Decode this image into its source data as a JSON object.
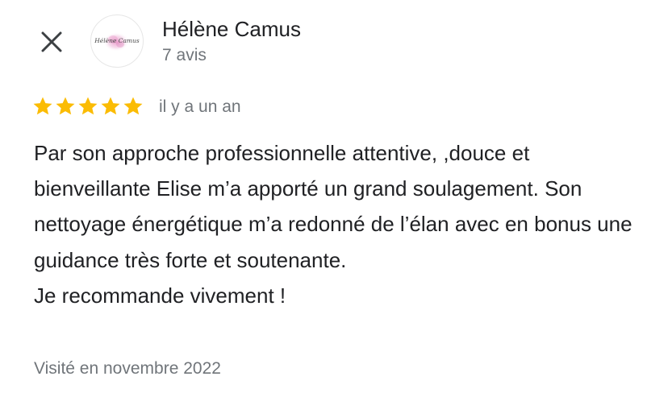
{
  "header": {
    "close_icon": "close-icon",
    "author": {
      "name": "Hélène Camus",
      "review_count": "7 avis",
      "avatar_signature": "Hélène Camus",
      "avatar_accent_color": "#e58ec2"
    }
  },
  "review": {
    "rating": 5,
    "max_rating": 5,
    "star_color": "#fbbc04",
    "date": "il y a un an",
    "text_paragraphs": [
      "Par son approche professionnelle attentive, ,douce et bienveillante Elise m’a apporté un grand soulagement. Son nettoyage énergétique m’a redonné de l’élan avec en bonus une guidance très forte et soutenante.",
      "Je recommande vivement !"
    ],
    "visit": "Visité en novembre 2022"
  }
}
